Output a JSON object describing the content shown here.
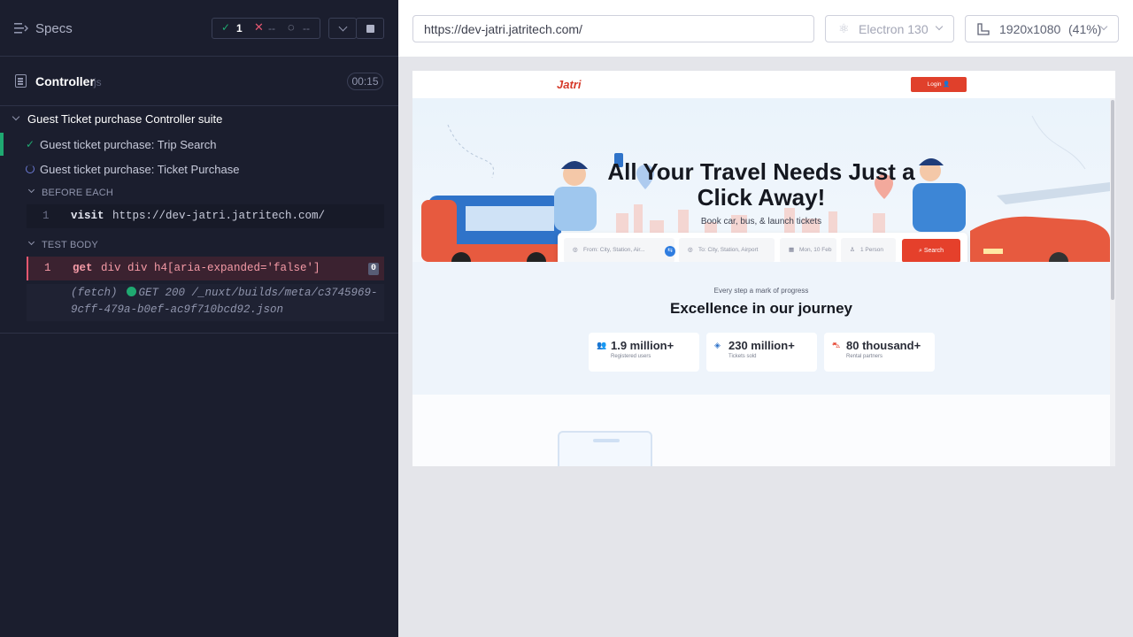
{
  "runner": {
    "specs_label": "Specs",
    "stats": {
      "passed": "1",
      "failed": "--",
      "pending": "--"
    },
    "file": {
      "name": "Controller",
      "ext": "js",
      "duration": "00:15"
    },
    "suite": "Guest Ticket purchase Controller suite",
    "tests": [
      {
        "label": "Guest ticket purchase: Trip Search",
        "state": "passed"
      },
      {
        "label": "Guest ticket purchase: Ticket Purchase",
        "state": "running"
      }
    ],
    "before_each": {
      "label": "BEFORE EACH",
      "command": {
        "num": "1",
        "name": "visit",
        "msg": "https://dev-jatri.jatritech.com/"
      }
    },
    "test_body": {
      "label": "TEST BODY",
      "command": {
        "num": "1",
        "name": "get",
        "msg": "div div h4[aria-expanded='false']",
        "count": "0"
      },
      "fetch": {
        "prefix": "(fetch)",
        "line1": "GET 200 /_nuxt/builds/meta/c3745969-",
        "line2": "9cff-479a-b0ef-ac9f710bcd92.json"
      }
    }
  },
  "toolbar": {
    "url": "https://dev-jatri.jatritech.com/",
    "browser": "Electron 130",
    "viewport": "1920x1080",
    "zoom": "(41%)"
  },
  "aut": {
    "logo": "Jatri",
    "login": "Login",
    "hero_title_1": "All Your Travel Needs Just a",
    "hero_title_2": "Click Away!",
    "hero_sub": "Book car, bus, & launch tickets",
    "search": {
      "from": "From: City, Station, Air...",
      "to": "To: City, Station, Airport",
      "date": "Mon, 10 Feb",
      "persons": "1 Person",
      "button": "Search"
    },
    "kicker": "Every step a mark of progress",
    "heading": "Excellence in our journey",
    "stats": [
      {
        "value": "1.9 million+",
        "label": "Registered users"
      },
      {
        "value": "230 million+",
        "label": "Tickets sold"
      },
      {
        "value": "80 thousand+",
        "label": "Rental partners"
      }
    ]
  },
  "colors": {
    "accent": "#e5402b",
    "passed": "#1fa971",
    "failed": "#e45770",
    "runner_bg": "#1b1e2e"
  }
}
